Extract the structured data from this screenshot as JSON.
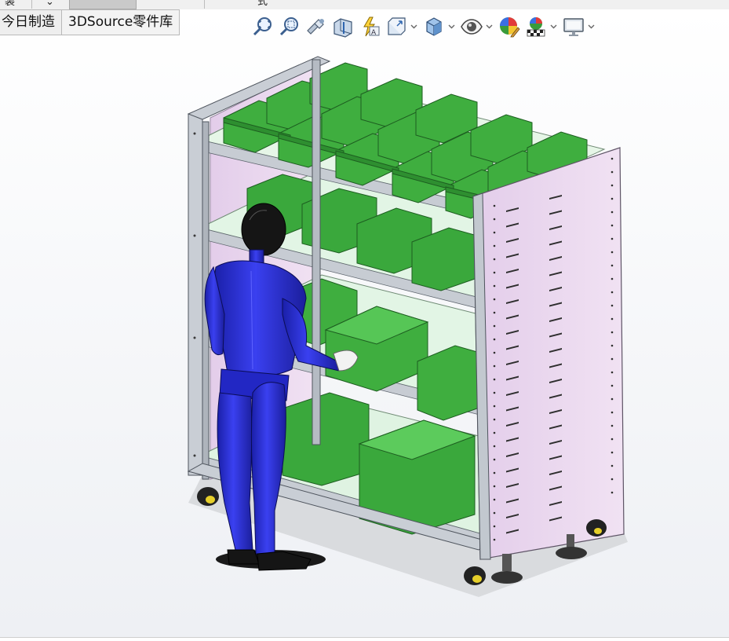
{
  "top_tabs_partial": {
    "left_label": "装",
    "mid_label": "⌄",
    "right_label": "式"
  },
  "tabs": [
    "今日制造",
    "3DSource零件库"
  ],
  "toolbar": {
    "buttons": [
      {
        "icon": "zoom-to-fit-icon",
        "has_dropdown": false
      },
      {
        "icon": "zoom-to-area-icon",
        "has_dropdown": false
      },
      {
        "icon": "previous-view-icon",
        "has_dropdown": false
      },
      {
        "icon": "section-view-icon",
        "has_dropdown": false
      },
      {
        "icon": "dynamic-annotation-views-icon",
        "has_dropdown": false
      },
      {
        "icon": "view-orientation-icon",
        "has_dropdown": true
      },
      {
        "icon": "display-style-icon",
        "has_dropdown": true
      },
      {
        "icon": "hide-show-items-icon",
        "has_dropdown": true
      },
      {
        "icon": "edit-appearance-icon",
        "has_dropdown": false
      },
      {
        "icon": "apply-scene-icon",
        "has_dropdown": true
      },
      {
        "icon": "view-settings-icon",
        "has_dropdown": true
      }
    ]
  },
  "colors": {
    "bin_green": "#3fae3f",
    "bin_green_dark": "#1f7a22",
    "panel_pink": "#ead7ee",
    "shelf_mint": "#e2f5e5",
    "frame_gray": "#c7ccd3",
    "figure_blue": "#2a2fd8",
    "figure_black": "#151515"
  }
}
